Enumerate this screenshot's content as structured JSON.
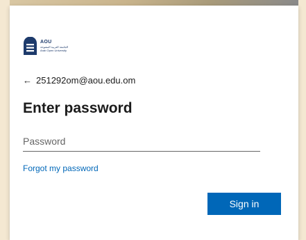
{
  "logo": {
    "abbr": "AOU",
    "arabic_name": "الجامعة العربية المفتوحة",
    "english_name": "Arab Open University"
  },
  "account": {
    "back_arrow": "←",
    "email": "251292om@aou.edu.om"
  },
  "page_title": "Enter password",
  "password_field": {
    "placeholder": "Password",
    "value": ""
  },
  "forgot_link": "Forgot my password",
  "sign_in_button": "Sign in",
  "colors": {
    "accent": "#0067b8",
    "logo": "#1d3a6b",
    "text": "#1b1b1b"
  }
}
